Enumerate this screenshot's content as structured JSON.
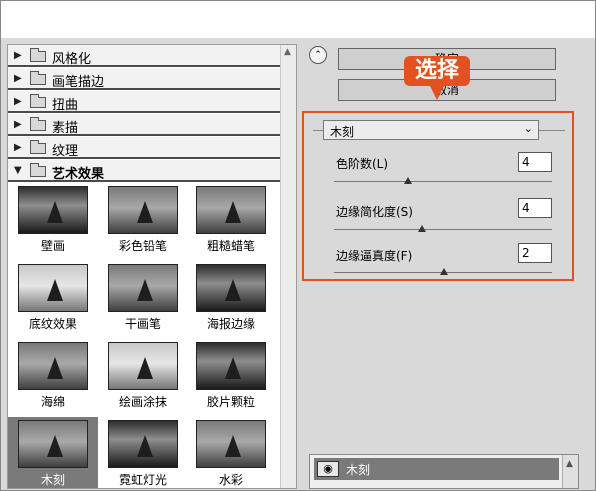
{
  "categories": [
    {
      "label": "风格化",
      "expanded": false
    },
    {
      "label": "画笔描边",
      "expanded": false
    },
    {
      "label": "扭曲",
      "expanded": false
    },
    {
      "label": "素描",
      "expanded": false
    },
    {
      "label": "纹理",
      "expanded": false
    },
    {
      "label": "艺术效果",
      "expanded": true
    }
  ],
  "thumbnails": [
    {
      "label": "壁画"
    },
    {
      "label": "彩色铅笔"
    },
    {
      "label": "粗糙蜡笔"
    },
    {
      "label": "底纹效果"
    },
    {
      "label": "干画笔"
    },
    {
      "label": "海报边缘"
    },
    {
      "label": "海绵"
    },
    {
      "label": "绘画涂抹"
    },
    {
      "label": "胶片颗粒"
    },
    {
      "label": "木刻"
    },
    {
      "label": "霓虹灯光"
    },
    {
      "label": "水彩"
    }
  ],
  "selected_thumbnail": "木刻",
  "buttons": {
    "ok": "确定",
    "cancel": "取消"
  },
  "callout": "选择",
  "filter_select": {
    "value": "木刻"
  },
  "params": [
    {
      "label": "色阶数(L)",
      "value": "4"
    },
    {
      "label": "边缘简化度(S)",
      "value": "4"
    },
    {
      "label": "边缘逼真度(F)",
      "value": "2"
    }
  ],
  "layer": {
    "label": "木刻"
  },
  "icons": {
    "tree_expand": "triangle-right-icon",
    "folder": "folder-icon",
    "collapse": "double-chevron-up-icon",
    "eye": "eye-icon"
  },
  "accent_color": "#e2511f"
}
